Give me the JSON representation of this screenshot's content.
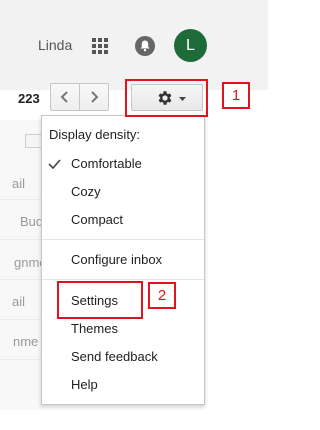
{
  "header": {
    "user_name": "Linda",
    "avatar_letter": "L",
    "avatar_color": "#1e6b3a"
  },
  "toolbar": {
    "range_text": "223"
  },
  "message_list": {
    "snippets": [
      "ail",
      "Bud",
      "gnme",
      "ail",
      "nme"
    ]
  },
  "settings_menu": {
    "display_density_heading": "Display density:",
    "density_options": [
      {
        "label": "Comfortable",
        "selected": true
      },
      {
        "label": "Cozy",
        "selected": false
      },
      {
        "label": "Compact",
        "selected": false
      }
    ],
    "configure_inbox": "Configure inbox",
    "settings": "Settings",
    "themes": "Themes",
    "send_feedback": "Send feedback",
    "help": "Help"
  },
  "annotations": {
    "label_1": "1",
    "label_2": "2",
    "color": "#e0141e"
  }
}
